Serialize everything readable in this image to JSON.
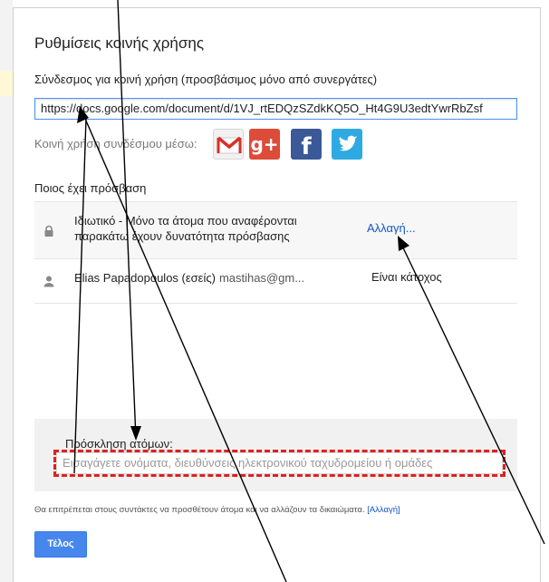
{
  "dialog": {
    "title": "Ρυθμίσεις κοινής χρήσης",
    "link_label": "Σύνδεσμος για κοινή χρήση (προσβάσιμος μόνο από συνεργάτες)",
    "link_value": "https://docs.google.com/document/d/1VJ_rtEDQzSZdkKQ5O_Ht4G9U3edtYwrRbZsf",
    "share_via_label": "Κοινή χρήση συνδέσμου μέσω:",
    "share_icons": [
      "gmail-icon",
      "google-plus-icon",
      "facebook-icon",
      "twitter-icon"
    ],
    "share_icon_text": {
      "gplus": "g+",
      "facebook": "f"
    },
    "access_label": "Ποιος έχει πρόσβαση",
    "rows": [
      {
        "icon": "lock-icon",
        "text_line1": "Ιδιωτικό - Μόνο τα άτομα που αναφέρονται",
        "text_line2": "παρακάτω έχουν δυνατότητα πρόσβασης",
        "action": "Αλλαγή..."
      },
      {
        "icon": "person-icon",
        "name": "Elias Papadopoulos (εσείς)",
        "email": "mastihas@gm...",
        "role": "Είναι κάτοχος"
      }
    ],
    "invite_label": "Πρόσκληση ατόμων:",
    "invite_placeholder": "Εισαγάγετε ονόματα, διευθύνσεις ηλεκτρονικού ταχυδρομείου ή ομάδες",
    "note_text": "Θα επιτρέπεται στους συντάκτες να προσθέτουν άτομα και να αλλάζουν τα δικαιώματα.",
    "note_link": "[Αλλαγή]",
    "done_label": "Τέλος"
  },
  "colors": {
    "accent_blue": "#4787ed",
    "link": "#1155cc",
    "annotation_red": "#e02020"
  }
}
